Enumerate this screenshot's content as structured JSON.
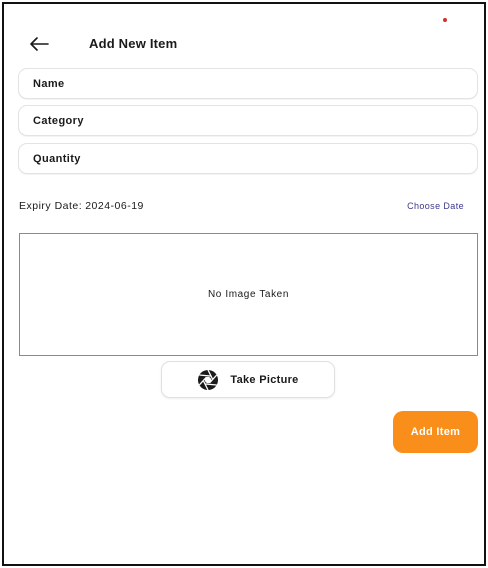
{
  "header": {
    "title": "Add New Item",
    "back_icon": "arrow-left-icon"
  },
  "form": {
    "name_placeholder": "Name",
    "category_placeholder": "Category",
    "quantity_placeholder": "Quantity"
  },
  "expiry": {
    "label": "Expiry Date:",
    "value": "2024-06-19",
    "choose_label": "Choose Date"
  },
  "image_preview": {
    "empty_text": "No Image Taken"
  },
  "take_picture": {
    "label": "Take Picture",
    "icon": "camera-aperture-icon"
  },
  "add_item": {
    "label": "Add Item"
  },
  "colors": {
    "accent": "#f98f1a",
    "link": "#3d3a8c",
    "status_dot": "#d32f2f"
  }
}
